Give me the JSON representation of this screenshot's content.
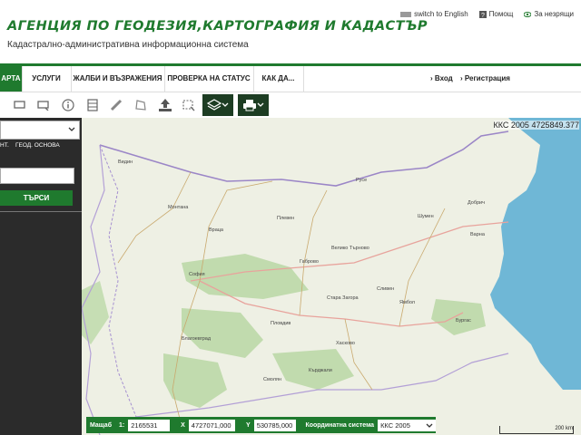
{
  "header": {
    "title": "АГЕНЦИЯ ПО ГЕОДЕЗИЯ,КАРТОГРАФИЯ И КАДАСТЪР",
    "subtitle": "Кадастрално-административна информационна система",
    "links": {
      "english": "switch to English",
      "help": "Помощ",
      "visually_impaired": "За незрящи"
    }
  },
  "nav": {
    "items": [
      "АРТА",
      "УСЛУГИ",
      "ЖАЛБИ И ВЪЗРАЖЕНИЯ",
      "ПРОВЕРКА НА СТАТУС",
      "КАК ДА..."
    ],
    "login": "Вход",
    "register": "Регистрация"
  },
  "sidebar": {
    "tabs": [
      "НТ.",
      "ГЕОД. ОСНОВА"
    ],
    "search_button": "ТЪРСИ"
  },
  "map": {
    "coords_readout": "ККС 2005 4725849.377",
    "labels": [
      "Варна",
      "Бургас",
      "София",
      "Пловдив",
      "Русе",
      "Плевен",
      "Стара Загора",
      "Шумен",
      "Добрич",
      "Враца",
      "Хасково",
      "Благоевград",
      "Велико Търново",
      "Ямбол",
      "Сливен",
      "Кърджали",
      "Смолян",
      "Монтана",
      "Видин",
      "Габрово"
    ],
    "scale_label": "200 km"
  },
  "statusbar": {
    "scale_label": "Мащаб",
    "scale_prefix": "1:",
    "scale_value": "2165531",
    "x_label": "X",
    "x_value": "4727071,000",
    "y_label": "Y",
    "y_value": "530785,000",
    "crs_label": "Координатна система",
    "crs_value": "ККС 2005"
  },
  "colors": {
    "brand_green": "#1f7a2e",
    "sea": "#6fb7d6",
    "forest": "#b5d6a0",
    "land": "#eef0e4"
  },
  "icons": [
    "rectangle-select-icon",
    "polygon-select-icon",
    "info-icon",
    "measure-area-icon",
    "ruler-icon",
    "polygon-icon",
    "upload-icon",
    "deselect-icon",
    "layers-icon",
    "printer-icon",
    "chevron-down-icon",
    "globe-icon",
    "help-icon",
    "eye-icon"
  ]
}
